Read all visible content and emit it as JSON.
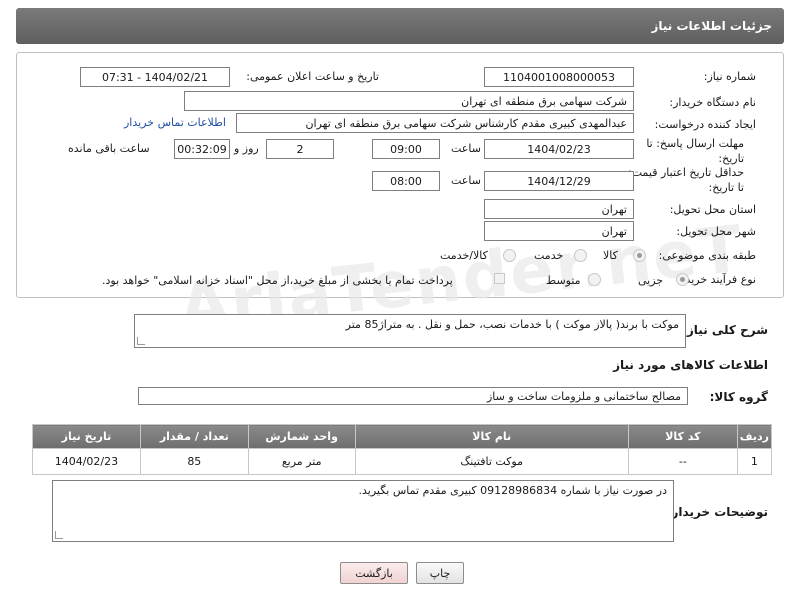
{
  "header": {
    "title": "جزئیات اطلاعات نیاز"
  },
  "form": {
    "need_number": {
      "label": "شماره نیاز:",
      "value": "1104001008000053"
    },
    "announce_datetime": {
      "label": "تاریخ و ساعت اعلان عمومی:",
      "value": "1404/02/21 - 07:31"
    },
    "buyer_org": {
      "label": "نام دستگاه خریدار:",
      "value": "شرکت سهامی برق منطقه ای تهران"
    },
    "requester": {
      "label": "ایجاد کننده درخواست:",
      "value": "عبدالمهدی کبیری مقدم کارشناس شرکت سهامی برق منطقه ای تهران",
      "contact_link": "اطلاعات تماس خریدار"
    },
    "reply_deadline": {
      "label_line1": "مهلت ارسال پاسخ: تا",
      "label_line2": "تاریخ:",
      "date": "1404/02/23",
      "time_label": "ساعت",
      "time": "09:00",
      "days": "2",
      "days_label": "روز و",
      "remaining": "00:32:09",
      "remaining_label": "ساعت باقی مانده"
    },
    "price_validity": {
      "label_line1": "حداقل تاریخ اعتبار قیمت:",
      "label_line2": "تا تاریخ:",
      "date": "1404/12/29",
      "time_label": "ساعت",
      "time": "08:00"
    },
    "delivery_province": {
      "label": "استان محل تحویل:",
      "value": "تهران"
    },
    "delivery_city": {
      "label": "شهر محل تحویل:",
      "value": "تهران"
    },
    "category": {
      "label": "طبقه بندی موضوعی:",
      "options": [
        "کالا",
        "خدمت",
        "کالا/خدمت"
      ],
      "selected": "کالا"
    },
    "purchase_process": {
      "label": "نوع فرآیند خرید :",
      "options": [
        "جزیی",
        "متوسط"
      ],
      "note": "پرداخت تمام یا بخشی از مبلغ خرید،از محل \"اسناد خزانه اسلامی\" خواهد بود."
    }
  },
  "description": {
    "label": "شرح کلی نیاز:",
    "value": "موکت با برند( پالاز موکت ) با خدمات نصب، حمل و نقل . به متراژ85 متر"
  },
  "goods_section": {
    "title": "اطلاعات کالاهای مورد نیاز",
    "group_label": "گروه کالا:",
    "group_value": "مصالح ساختمانی و ملزومات ساخت و ساز"
  },
  "table": {
    "headers": [
      "ردیف",
      "کد کالا",
      "نام کالا",
      "واحد شمارش",
      "تعداد / مقدار",
      "تاریخ نیاز"
    ],
    "rows": [
      [
        "1",
        "--",
        "موکت تافتینگ",
        "متر مربع",
        "85",
        "1404/02/23"
      ]
    ]
  },
  "buyer_notes": {
    "label": "توضیحات خریدار:",
    "value": "در صورت نیاز با شماره 09128986834 کبیری مقدم تماس بگیرید."
  },
  "buttons": {
    "print": "چاپ",
    "back": "بازگشت"
  },
  "watermark": "AriaTender.neT",
  "colors": {
    "header_bg": "#6b6b6b",
    "link": "#1d4fa5",
    "back_button_bg": "#f7dede"
  }
}
